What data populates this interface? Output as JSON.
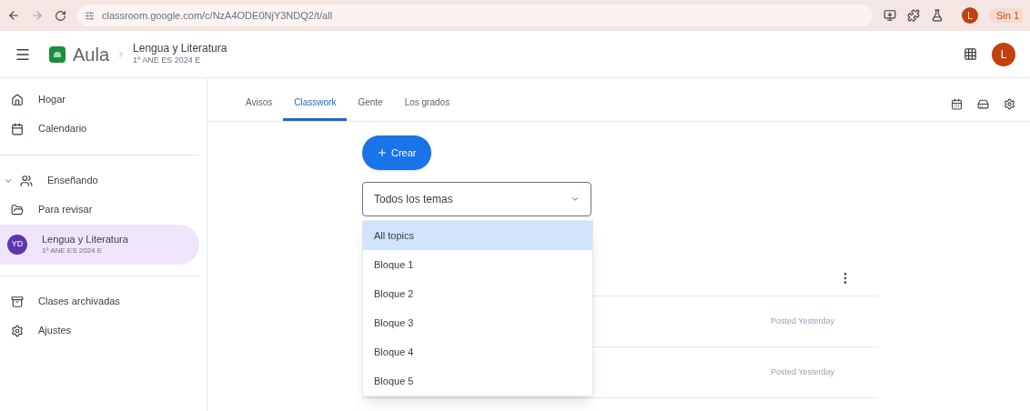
{
  "browser": {
    "url": "classroom.google.com/c/NzA4ODE0NjY3NDQ2/t/all",
    "profile_initial": "L",
    "pill": "Sin 1"
  },
  "header": {
    "app": "Aula",
    "class_name": "Lengua y Literatura",
    "class_section": "1º ANE ES 2024 E",
    "avatar": "L"
  },
  "sidebar": {
    "items": [
      {
        "kind": "home",
        "label": "Hogar",
        "selected": false
      },
      {
        "kind": "calendar",
        "label": "Calendario",
        "selected": false
      },
      {
        "kind": "divider"
      },
      {
        "kind": "teaching",
        "label": "Enseñando",
        "selected": false,
        "expanded": true
      },
      {
        "kind": "review",
        "label": "Para revisar",
        "selected": false
      },
      {
        "kind": "class",
        "label": "Lengua y Literatura",
        "sublabel": "1º ANE ES 2024 E",
        "initials": "YD",
        "color": "#5e35b1",
        "selected": true
      },
      {
        "kind": "divider"
      },
      {
        "kind": "archive",
        "label": "Clases archivadas",
        "selected": false
      },
      {
        "kind": "settings",
        "label": "Ajustes",
        "selected": false
      }
    ]
  },
  "tabs": [
    {
      "label": "Avisos",
      "selected": false
    },
    {
      "label": "Classwork",
      "selected": true
    },
    {
      "label": "Gente",
      "selected": false
    },
    {
      "label": "Los grados",
      "selected": false
    }
  ],
  "create_button": "Crear",
  "topic_select": {
    "value": "Todos los temas",
    "expanded": true,
    "options": [
      {
        "label": "All topics",
        "selected": true
      },
      {
        "label": "Bloque 1",
        "selected": false
      },
      {
        "label": "Bloque 2",
        "selected": false
      },
      {
        "label": "Bloque 3",
        "selected": false
      },
      {
        "label": "Bloque 4",
        "selected": false
      },
      {
        "label": "Bloque 5",
        "selected": false
      }
    ]
  },
  "posts": [
    {
      "posted": "Posted Yesterday"
    },
    {
      "posted": "Posted Yesterday"
    }
  ]
}
